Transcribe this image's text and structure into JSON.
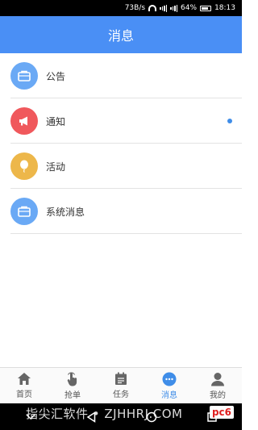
{
  "status_bar": {
    "speed": "73B/s",
    "battery": "64%",
    "time": "18:13"
  },
  "header": {
    "title": "消息"
  },
  "messages": [
    {
      "label": "公告",
      "icon": "briefcase-icon",
      "color": "#6aa9f5",
      "unread": false
    },
    {
      "label": "通知",
      "icon": "megaphone-icon",
      "color": "#f0585c",
      "unread": true
    },
    {
      "label": "活动",
      "icon": "balloon-icon",
      "color": "#edb74a",
      "unread": false
    },
    {
      "label": "系统消息",
      "icon": "briefcase-icon",
      "color": "#6aa9f5",
      "unread": false
    }
  ],
  "tabs": [
    {
      "label": "首页",
      "icon": "home-icon",
      "active": false
    },
    {
      "label": "抢单",
      "icon": "tap-hand-icon",
      "active": false
    },
    {
      "label": "任务",
      "icon": "calendar-icon",
      "active": false
    },
    {
      "label": "消息",
      "icon": "chat-icon",
      "active": true
    },
    {
      "label": "我的",
      "icon": "user-icon",
      "active": false
    }
  ],
  "watermark": {
    "text": "指尖汇软件 • ZJHHRJ.COM",
    "logo": "pc6"
  },
  "colors": {
    "primary": "#4a8ff5",
    "active_tab": "#3f8de8",
    "unread_dot": "#3f8de8"
  }
}
